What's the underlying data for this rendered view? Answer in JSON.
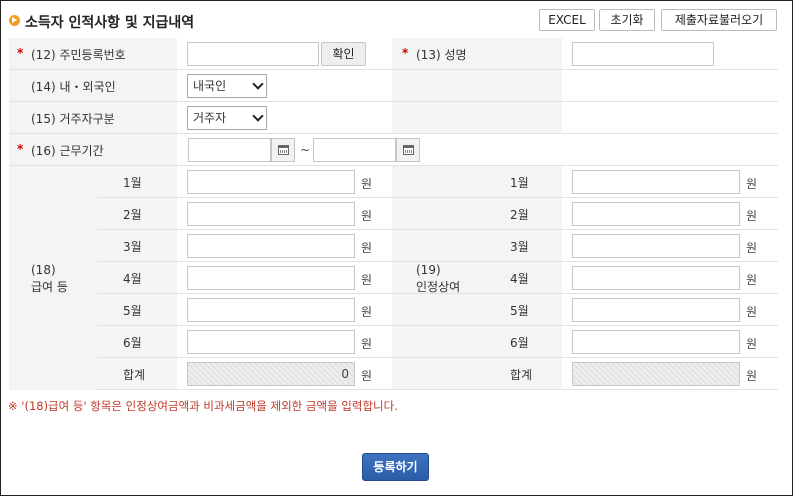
{
  "header": {
    "title": "소득자 인적사항 및 지급내역",
    "excel_label": "EXCEL",
    "reset_label": "초기화",
    "load_label": "제출자료불러오기"
  },
  "form": {
    "required_mark": "*",
    "resident_no_label": "(12) 주민등록번호",
    "resident_no_value": "",
    "confirm_label": "확인",
    "name_label": "(13) 성명",
    "name_value": "",
    "nationality_label": "(14) 내・외국인",
    "nationality_selected": "내국인",
    "residency_label": "(15) 거주자구분",
    "residency_selected": "거주자",
    "period_label": "(16) 근무기간",
    "period_from": "",
    "period_to": "",
    "period_sep": "~"
  },
  "salary": {
    "section_no": "(18)",
    "section_name": "급여 등",
    "months": [
      "1월",
      "2월",
      "3월",
      "4월",
      "5월",
      "6월"
    ],
    "values": [
      "",
      "",
      "",
      "",
      "",
      ""
    ],
    "total_label": "합계",
    "total_value": "0",
    "unit": "원"
  },
  "bonus": {
    "section_no": "(19)",
    "section_name": "인정상여",
    "months": [
      "1월",
      "2월",
      "3월",
      "4월",
      "5월",
      "6월"
    ],
    "values": [
      "",
      "",
      "",
      "",
      "",
      ""
    ],
    "total_label": "합계",
    "total_value": "",
    "unit": "원"
  },
  "note": "※ '(18)급여 등' 항목은 인정상여금액과 비과세금액을 제외한 금액을 입력합니다.",
  "submit_label": "등록하기",
  "colors": {
    "accent": "#2b5ca7",
    "required": "#cc0000",
    "note": "#c0392b",
    "bullet": "#f0a020"
  }
}
